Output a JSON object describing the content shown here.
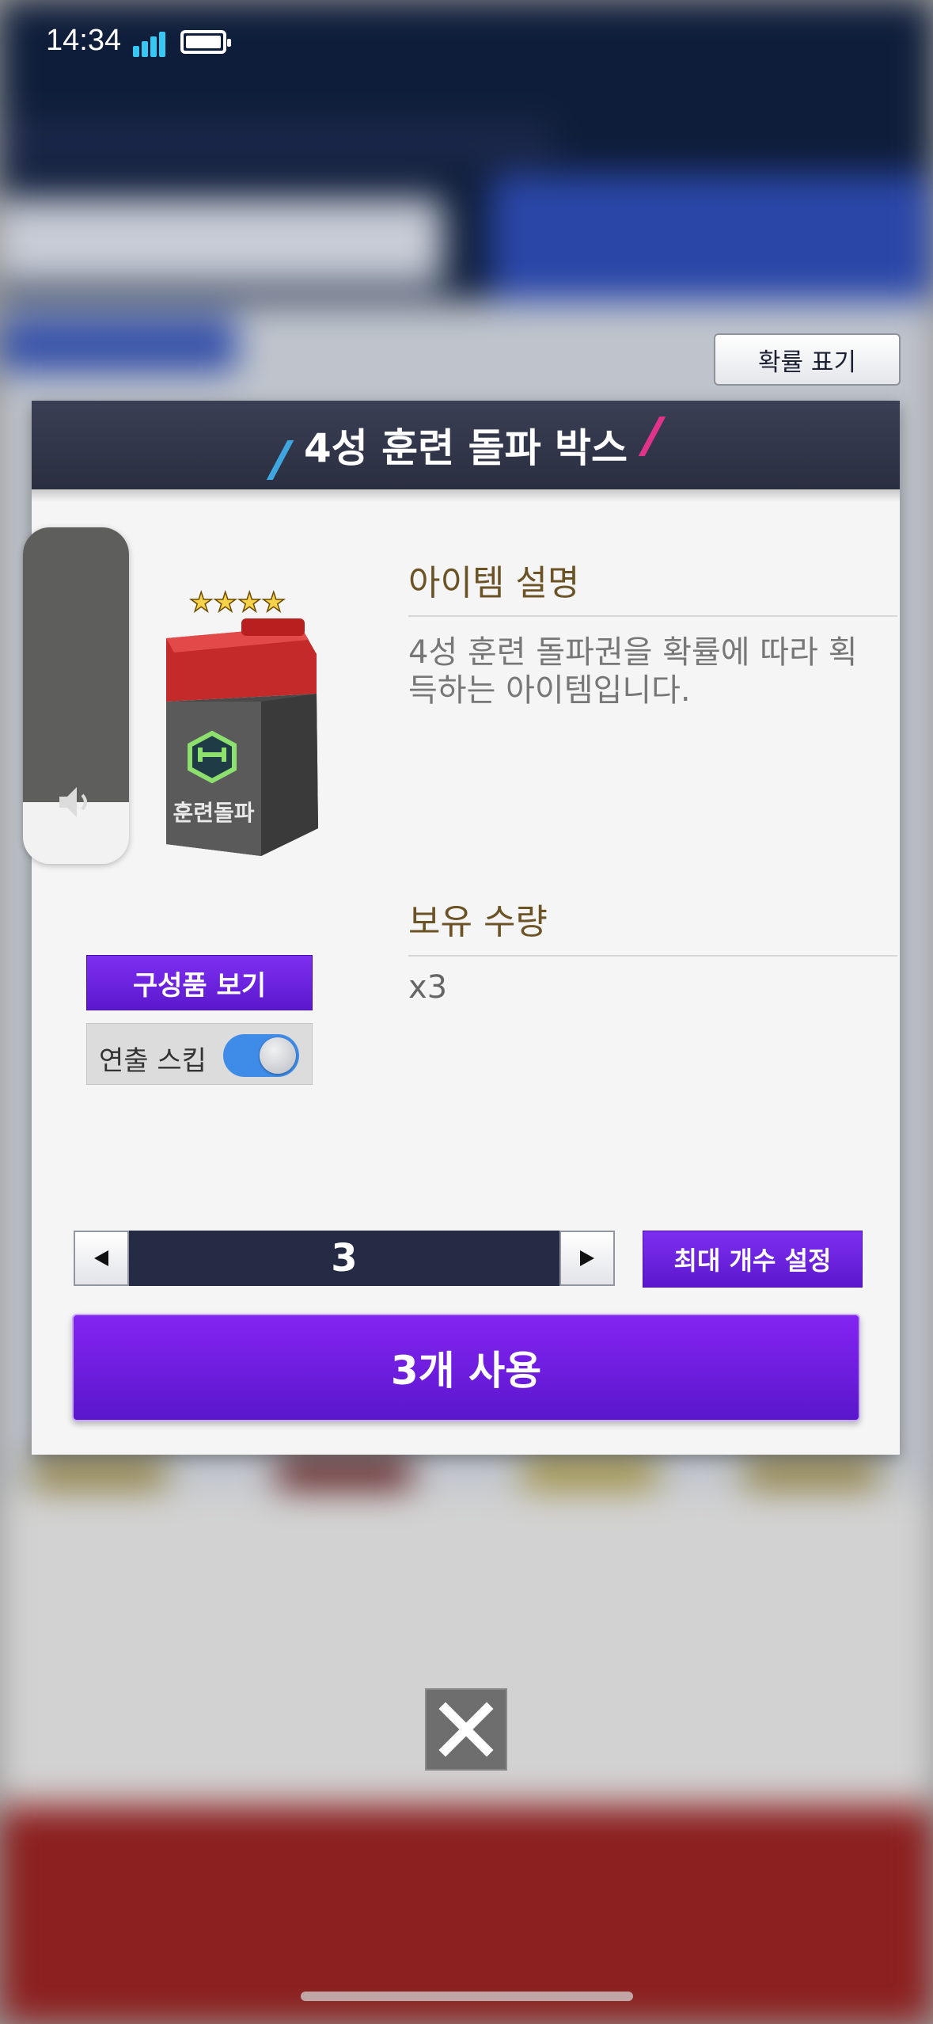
{
  "status_bar": {
    "time": "14:34"
  },
  "probability_button_label": "확률 표기",
  "dialog": {
    "title": "4성 훈련 돌파 박스",
    "item_image_label": "훈련돌파",
    "item_stars": "★★★★",
    "description_heading": "아이템 설명",
    "description_text": "4성 훈련 돌파권을 확률에 따라 획득하는 아이템입니다.",
    "owned_heading": "보유 수량",
    "owned_value": "x3",
    "components_button": "구성품 보기",
    "skip_label": "연출 스킵",
    "skip_enabled": true,
    "quantity": "3",
    "max_button": "최대 개수 설정",
    "use_button": "3개 사용"
  },
  "colors": {
    "header": "#2f3447",
    "purple": "#6a1fe0",
    "title_gold": "#6b5326",
    "toggle_on": "#3f8ce8"
  }
}
